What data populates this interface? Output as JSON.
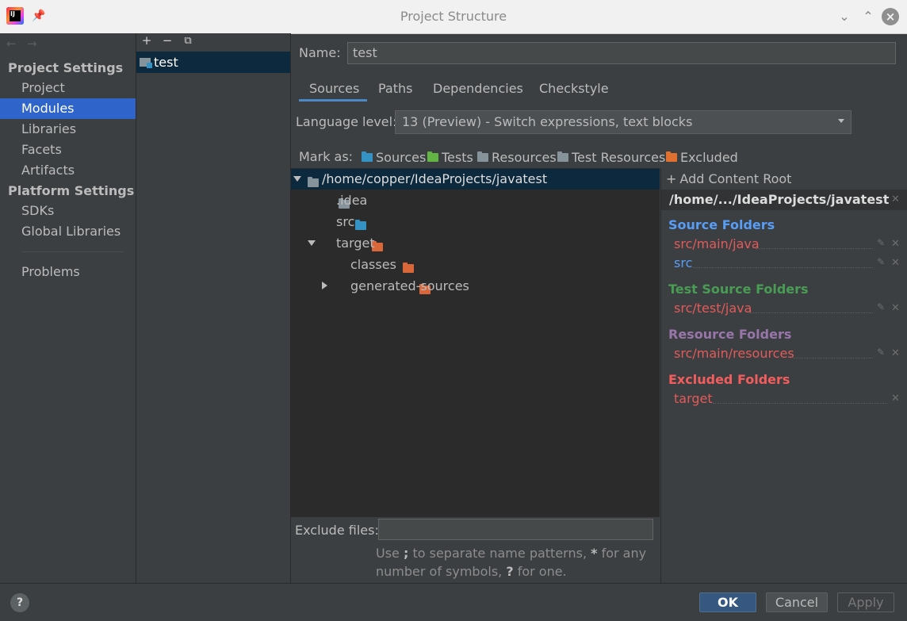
{
  "window": {
    "title": "Project Structure",
    "app_icon_text": "IJ"
  },
  "nav": {
    "section_project": "Project Settings",
    "items_project": [
      "Project",
      "Modules",
      "Libraries",
      "Facets",
      "Artifacts"
    ],
    "selected": "Modules",
    "section_platform": "Platform Settings",
    "items_platform": [
      "SDKs",
      "Global Libraries"
    ],
    "problems": "Problems"
  },
  "modules": {
    "toolbar": [
      "add-icon",
      "remove-icon",
      "copy-icon"
    ],
    "list": [
      "test"
    ]
  },
  "module": {
    "name_label": "Name:",
    "name_value": "test",
    "tabs": [
      "Sources",
      "Paths",
      "Dependencies",
      "Checkstyle"
    ],
    "active_tab": "Sources",
    "language_label": "Language level:",
    "language_value": "13 (Preview) - Switch expressions, text blocks",
    "mark_as_label": "Mark as:",
    "mark_as": [
      {
        "label": "Sources",
        "color": "#3592c4"
      },
      {
        "label": "Tests",
        "color": "#62b543"
      },
      {
        "label": "Resources",
        "color": "#87939a"
      },
      {
        "label": "Test Resources",
        "color": "#87939a"
      },
      {
        "label": "Excluded",
        "color": "#e07030"
      }
    ]
  },
  "tree": {
    "root": "/home/copper/IdeaProjects/javatest",
    "nodes": [
      {
        "label": ".idea",
        "color": "#87939a"
      },
      {
        "label": "src",
        "color": "#3592c4"
      },
      {
        "label": "target",
        "color": "#d9673a"
      },
      {
        "label": "classes",
        "color": "#d9673a"
      },
      {
        "label": "generated-sources",
        "color": "#d9673a"
      }
    ]
  },
  "exclude": {
    "label": "Exclude files:",
    "value": "",
    "hint_parts": [
      "Use ",
      ";",
      " to separate name patterns, ",
      "*",
      " for any number of symbols, ",
      "?",
      " for one."
    ]
  },
  "content_root": {
    "add_label": "Add Content Root",
    "path": "/home/.../IdeaProjects/javatest",
    "source_title": "Source Folders",
    "source_items": [
      "src/main/java",
      "src"
    ],
    "test_title": "Test Source Folders",
    "test_items": [
      "src/test/java"
    ],
    "resource_title": "Resource Folders",
    "resource_items": [
      "src/main/resources"
    ],
    "excluded_title": "Excluded Folders",
    "excluded_items": [
      "target"
    ],
    "colors": {
      "source": "#589df6",
      "test": "#499c54",
      "resource": "#9876aa",
      "excluded": "#f35d5d",
      "entry_red": "#e25a5a",
      "entry_blue": "#589df6"
    }
  },
  "buttons": {
    "help": "?",
    "ok": "OK",
    "cancel": "Cancel",
    "apply": "Apply"
  }
}
